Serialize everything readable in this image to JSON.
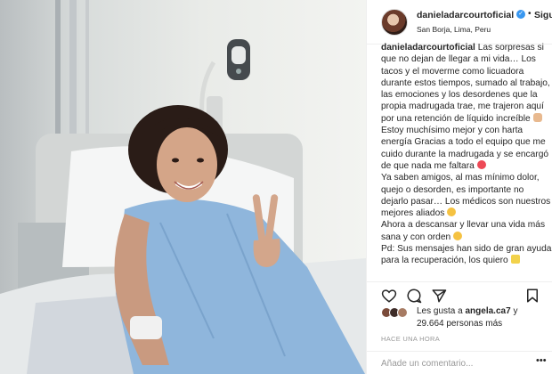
{
  "header": {
    "username": "danieladarcourtoficial",
    "verified_badge": "✓",
    "separator": "•",
    "follow_label": "Siguiendo",
    "location": "San Borja, Lima, Peru"
  },
  "caption": {
    "username": "danieladarcourtoficial",
    "paragraphs": [
      "Las sorpresas si que no dejan de llegar a mi vida… Los tacos y el moverme como licuadora durante estos tiempos, sumado al trabajo, las emociones y los desordenes que la propia madrugada trae, me trajeron aquí por una retención de líquido increíble",
      "Estoy muchísimo mejor y con harta energía Gracias a todo el equipo que me cuido durante la madrugada y se encargó de que nada me faltara",
      "Ya saben amigos, al mas mínimo dolor, quejo o desorden, es importante no dejarlo pasar… Los médicos son nuestros mejores aliados",
      "Ahora a descansar y llevar una vida más sana y con orden",
      "Pd: Sus mensajes han sido de gran ayuda para la recuperación, los quiero"
    ],
    "emoji_icons": [
      "hand-icon",
      "heart-icon",
      "smile-icon",
      "smile-icon",
      "sparkle-icon"
    ]
  },
  "likes": {
    "prefix": "Les gusta a",
    "user": "angela.ca7",
    "connector": "y",
    "count_line": "29.664 personas más"
  },
  "timestamp": "HACE UNA HORA",
  "comment": {
    "placeholder": "Añade un comentario...",
    "more": "•••"
  },
  "colors": {
    "verified": "#3897f0",
    "heart": "#ed4956",
    "gown": "#8fb6dc"
  }
}
